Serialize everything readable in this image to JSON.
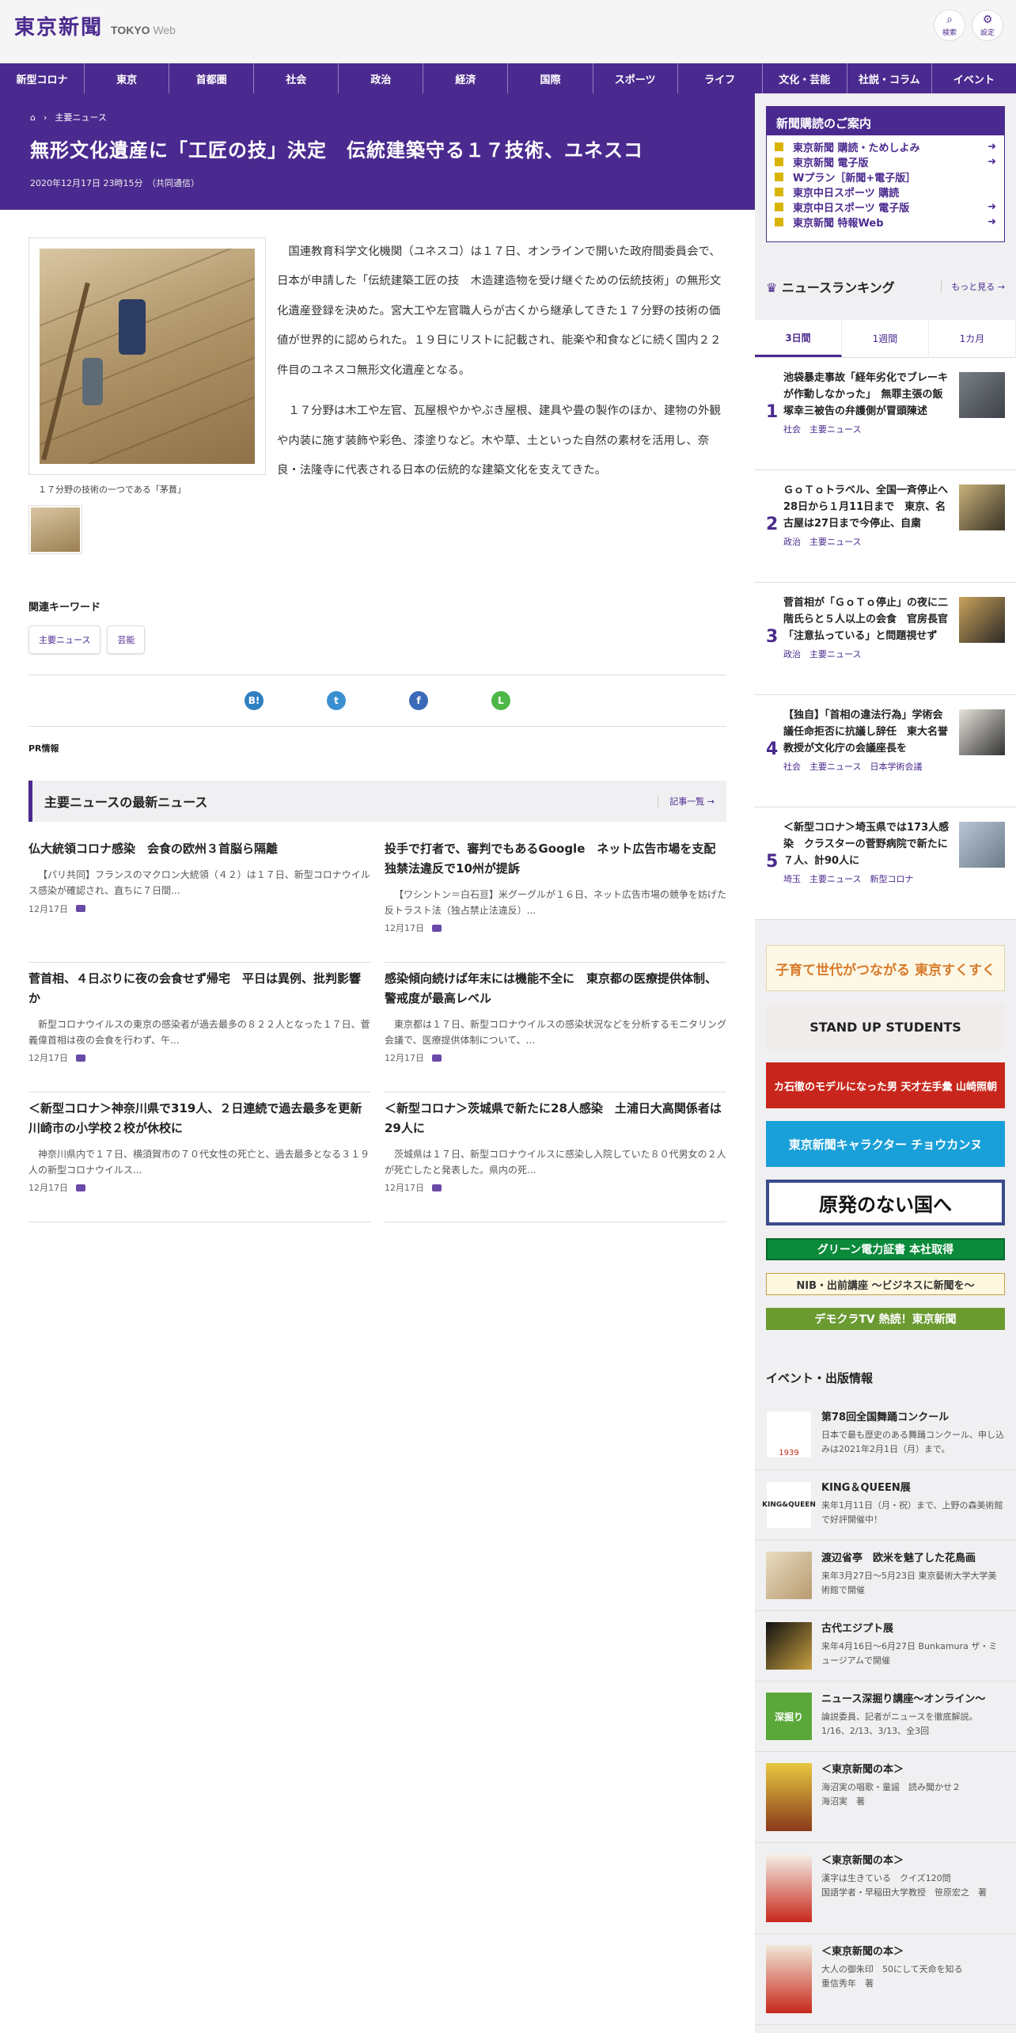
{
  "header": {
    "logo_jp": "東京新聞",
    "logo_en": "TOKYO",
    "logo_web": "Web",
    "search_label": "検索",
    "settings_label": "設定"
  },
  "nav": [
    "新型コロナ",
    "東京",
    "首都圏",
    "社会",
    "政治",
    "経済",
    "国際",
    "スポーツ",
    "ライフ",
    "文化・芸能",
    "社説・コラム",
    "イベント"
  ],
  "article": {
    "breadcrumb": "主要ニュース",
    "title": "無形文化遺産に「工匠の技」決定　伝統建築守る１７技術、ユネスコ",
    "date": "2020年12月17日 23時15分　（共同通信）",
    "caption": "１７分野の技術の一つである「茅葺」",
    "paragraphs": [
      "国連教育科学文化機関（ユネスコ）は１７日、オンラインで開いた政府間委員会で、日本が申請した「伝統建築工匠の技　木造建造物を受け継ぐための伝統技術」の無形文化遺産登録を決めた。宮大工や左官職人らが古くから継承してきた１７分野の技術の価値が世界的に認められた。１９日にリストに記載され、能楽や和食などに続く国内２２件目のユネスコ無形文化遺産となる。",
      "１７分野は木工や左官、瓦屋根やかやぶき屋根、建具や畳の製作のほか、建物の外観や内装に施す装飾や彩色、漆塗りなど。木や草、土といった自然の素材を活用し、奈良・法隆寺に代表される日本の伝統的な建築文化を支えてきた。"
    ],
    "keywords_title": "関連キーワード",
    "keywords": [
      "主要ニュース",
      "芸能"
    ],
    "pr_label": "PR情報"
  },
  "share": {
    "hatena": "B!",
    "twitter": "t",
    "facebook": "f",
    "line": "L"
  },
  "latest": {
    "title": "主要ニュースの最新ニュース",
    "more": "記事一覧",
    "items": [
      {
        "title": "仏大統領コロナ感染　会食の欧州３首脳ら隔離",
        "summary": "【パリ共同】フランスのマクロン大統領（４２）は１７日、新型コロナウイルス感染が確認され、直ちに７日間...",
        "date": "12月17日"
      },
      {
        "title": "投手で打者で、審判でもあるGoogle　ネット広告市場を支配　独禁法違反で10州が提訴",
        "summary": "【ワシントン＝白石亘】米グーグルが１６日、ネット広告市場の競争を妨げた反トラスト法（独占禁止法違反）...",
        "date": "12月17日"
      },
      {
        "title": "菅首相、４日ぶりに夜の会食せず帰宅　平日は異例、批判影響か",
        "summary": "新型コロナウイルスの東京の感染者が過去最多の８２２人となった１７日、菅義偉首相は夜の会食を行わず、午...",
        "date": "12月17日"
      },
      {
        "title": "感染傾向続けば年末には機能不全に　東京都の医療提供体制、警戒度が最高レベル",
        "summary": "東京都は１７日、新型コロナウイルスの感染状況などを分析するモニタリング会議で、医療提供体制について、...",
        "date": "12月17日"
      },
      {
        "title": "＜新型コロナ＞神奈川県で319人、２日連続で過去最多を更新　川崎市の小学校２校が休校に",
        "summary": "神奈川県内で１７日、横須賀市の７０代女性の死亡と、過去最多となる３１９人の新型コロナウイルス...",
        "date": "12月17日"
      },
      {
        "title": "＜新型コロナ＞茨城県で新たに28人感染　土浦日大高関係者は29人に",
        "summary": "茨城県は１７日、新型コロナウイルスに感染し入院していた８０代男女の２人が死亡したと発表した。県内の死...",
        "date": "12月17日"
      }
    ]
  },
  "sidebar": {
    "subscribe_title": "新聞購読のご案内",
    "subscribe_items": [
      {
        "label": "東京新聞 購読・ためしよみ",
        "arrow": "➜"
      },
      {
        "label": "東京新聞 電子版",
        "arrow": "➜"
      },
      {
        "label": "Wプラン［新聞+電子版］",
        "arrow": ""
      },
      {
        "label": "東京中日スポーツ 購読",
        "arrow": ""
      },
      {
        "label": "東京中日スポーツ 電子版",
        "arrow": "➜"
      },
      {
        "label": "東京新聞 特報Web",
        "arrow": "➜"
      }
    ],
    "ranking_title": "ニュースランキング",
    "ranking_more": "もっと見る",
    "tabs": [
      "3日間",
      "1週間",
      "1カ月"
    ],
    "ranking": [
      {
        "n": "1",
        "title": "池袋暴走事故「経年劣化でブレーキが作動しなかった」　無罪主張の飯塚幸三被告の弁護側が冒頭陳述",
        "tags": "社会　主要ニュース"
      },
      {
        "n": "2",
        "title": "ＧｏＴｏトラベル、全国一斉停止へ　28日から１月11日まで　東京、名古屋は27日まで今停止、自粛",
        "tags": "政治　主要ニュース"
      },
      {
        "n": "3",
        "title": "菅首相が「ＧｏＴｏ停止」の夜に二階氏らと５人以上の会食　官房長官「注意払っている」と問題視せず",
        "tags": "政治　主要ニュース"
      },
      {
        "n": "4",
        "title": "【独自】「首相の違法行為」学術会議任命拒否に抗議し辞任　東大名誉教授が文化庁の会議座長を",
        "tags": "社会　主要ニュース　日本学術会議"
      },
      {
        "n": "5",
        "title": "＜新型コロナ＞埼玉県では173人感染　クラスターの菅野病院で新たに７人、計90人に",
        "tags": "埼玉　主要ニュース　新型コロナ"
      }
    ],
    "banners": [
      "子育て世代がつながる 東京すくすく",
      "STAND UP STUDENTS",
      "カ石徹のモデルになった男 天才左手彙 山崎照朝",
      "東京新聞キャラクター チョウカンヌ",
      "原発のない国へ",
      "グリーン電力証書 本社取得",
      "NIB・出前講座 〜ビジネスに新聞を〜",
      "デモクラTV 熱読！東京新聞"
    ],
    "events_title": "イベント・出版情報",
    "events": [
      {
        "title": "第78回全国舞踊コンクール",
        "desc": "日本で最も歴史のある舞踊コンクール、申し込みは2021年2月1日（月）まで。",
        "icon": "1939"
      },
      {
        "title": "KING＆QUEEN展",
        "desc": "来年1月11日（月・祝）まで、上野の森美術館で好評開催中！",
        "icon": "KING&QUEEN"
      },
      {
        "title": "渡辺省亭　欧米を魅了した花鳥画",
        "desc": "来年3月27日～5月23日 東京藝術大学大学美術館で開催",
        "icon": ""
      },
      {
        "title": "古代エジプト展",
        "desc": "来年4月16日～6月27日 Bunkamura ザ・ミュージアムで開催",
        "icon": ""
      },
      {
        "title": "ニュース深掘り講座～オンライン～",
        "desc": "論説委員、記者がニュースを徹底解説。1/16、2/13、3/13、全3回",
        "icon": "深掘り"
      },
      {
        "title": "＜東京新聞の本＞",
        "desc": "海沼実の唱歌・童謡　読み聞かせ２\n海沼実　著",
        "icon": ""
      },
      {
        "title": "＜東京新聞の本＞",
        "desc": "漢字は生きている　クイズ120問\n国語学者・早稲田大学教授　笹原宏之　著",
        "icon": ""
      },
      {
        "title": "＜東京新聞の本＞",
        "desc": "大人の御朱印　50にして天命を知る\n重信秀年　著",
        "icon": ""
      }
    ]
  }
}
